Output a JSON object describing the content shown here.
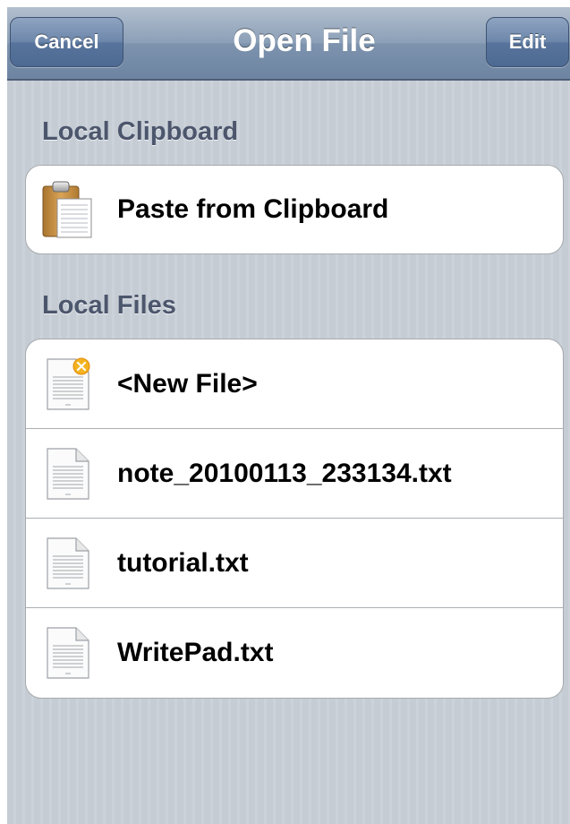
{
  "navbar": {
    "title": "Open File",
    "cancel_label": "Cancel",
    "edit_label": "Edit"
  },
  "clipboard_section": {
    "header": "Local Clipboard",
    "items": [
      {
        "label": "Paste from Clipboard",
        "icon": "clipboard-icon"
      }
    ]
  },
  "files_section": {
    "header": "Local Files",
    "items": [
      {
        "label": "<New File>",
        "icon": "new-file-icon"
      },
      {
        "label": "note_20100113_233134.txt",
        "icon": "text-file-icon"
      },
      {
        "label": "tutorial.txt",
        "icon": "text-file-icon"
      },
      {
        "label": "WritePad.txt",
        "icon": "text-file-icon"
      }
    ]
  },
  "colors": {
    "navbar": "#6d84a2",
    "background": "#c5ccd4",
    "section_header": "#4c566c"
  }
}
